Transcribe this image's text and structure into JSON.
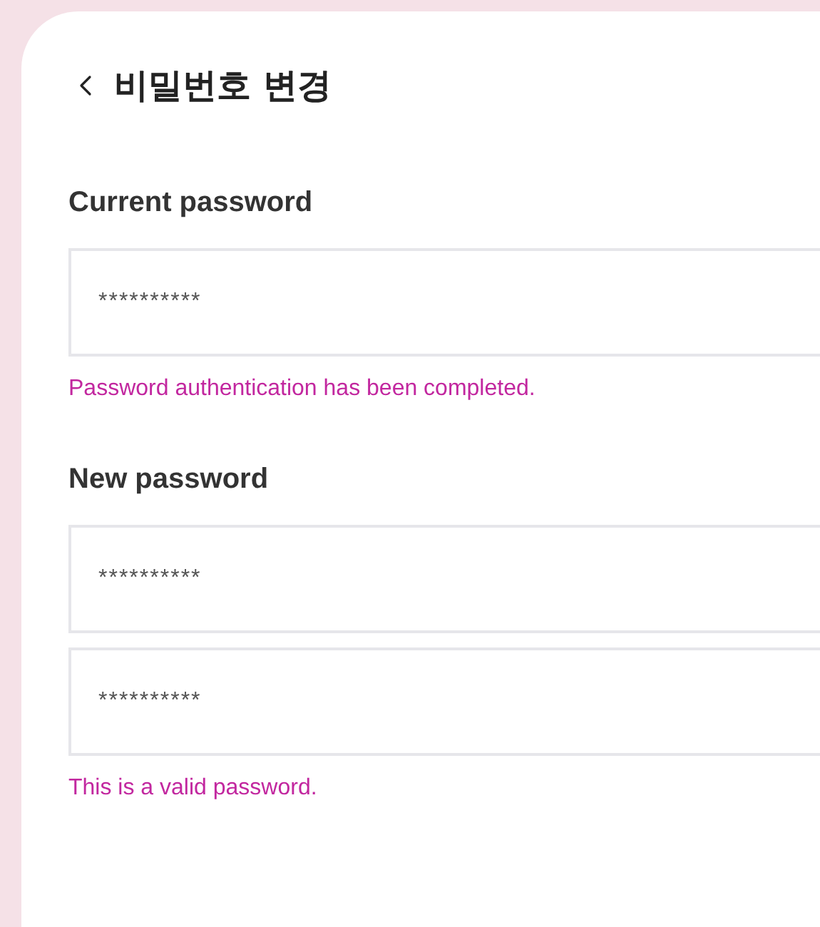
{
  "header": {
    "title": "비밀번호 변경"
  },
  "sections": [
    {
      "label": "Current password",
      "fields": [
        {
          "value": "**********"
        }
      ],
      "message": "Password authentication has been completed."
    },
    {
      "label": "New password",
      "fields": [
        {
          "value": "**********"
        },
        {
          "value": "**********"
        }
      ],
      "message": "This is a valid password."
    }
  ]
}
